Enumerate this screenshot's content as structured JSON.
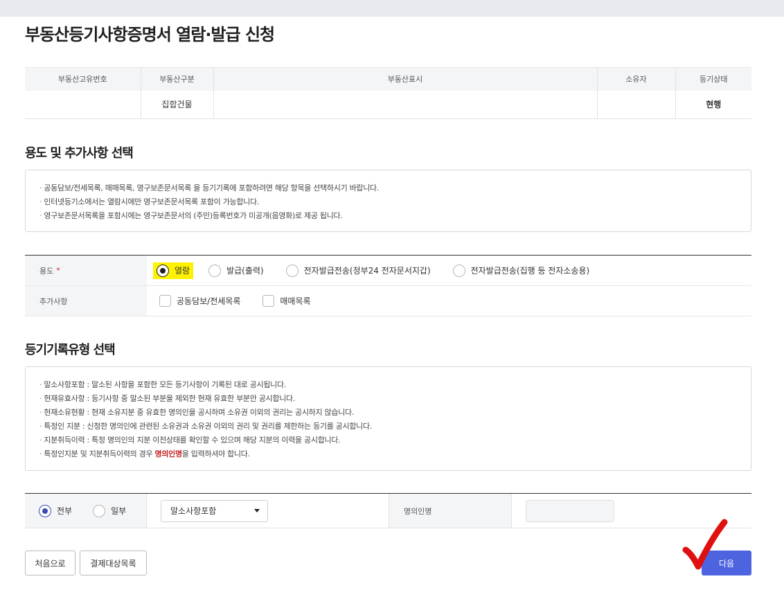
{
  "page_title": "부동산등기사항증명서 열람·발급 신청",
  "property_table": {
    "headers": [
      "부동산고유번호",
      "부동산구분",
      "부동산표시",
      "소유자",
      "등기상태"
    ],
    "row": [
      "",
      "집합건물",
      "",
      "",
      "현행"
    ]
  },
  "purpose_section": {
    "title": "용도 및 추가사항 선택",
    "notices": [
      "공동담보/전세목록, 매매목록, 영구보존문서목록 을 등기기록에 포함하려면 해당 항목을 선택하시기 바랍니다.",
      "인터넷등기소에서는 열람시에만 영구보존문서목록 포함이 가능합니다.",
      "영구보존문서목록을 포함시에는 영구보존문서의 (주민)등록번호가 미공개(음영화)로 제공 됩니다."
    ],
    "purpose_label": "용도",
    "required_mark": "*",
    "purpose_options": [
      "열람",
      "발급(출력)",
      "전자발급전송(정부24 전자문서지갑)",
      "전자발급전송(집행 등 전자소송용)"
    ],
    "purpose_selected": "열람",
    "extras_label": "추가사항",
    "extras_options": [
      "공동담보/전세목록",
      "매매목록"
    ]
  },
  "record_section": {
    "title": "등기기록유형 선택",
    "notices": [
      "말소사항포함 : 말소된 사항을 포함한 모든 등기사항이 기록된 대로 공시됩니다.",
      "현재유효사항 : 등기사항 중 말소된 부분을 제외한 현재 유효한 부분만 공시합니다.",
      "현재소유현황 : 현재 소유지분 중 유효한 명의인을 공시하며 소유권 이외의 권리는 공시하지 않습니다.",
      "특정인 지분 : 신청한 명의인에 관련된 소유권과 소유권 이외의 권리 및 권리를 제한하는 등기를 공시합니다.",
      "지분취득이력 : 특정 명의인의 지분 이전상태를 확인할 수 있으며 해당 지분의 이력을 공시합니다."
    ],
    "last_notice_prefix": "특정인지분 및 지분취득이력의 경우 ",
    "last_notice_emphasis": "명의인명",
    "last_notice_suffix": "을 입력하셔야 합니다.",
    "scope_options": [
      "전부",
      "일부"
    ],
    "scope_selected": "전부",
    "record_type_value": "말소사항포함",
    "owner_name_label": "명의인명",
    "owner_name_value": ""
  },
  "buttons": {
    "first": "처음으로",
    "payment_list": "결제대상목록",
    "next": "다음"
  },
  "colors": {
    "primary": "#4d63e0",
    "highlight": "#fff200",
    "annotation_red": "#e01010",
    "status_blue": "#3b4bb0"
  }
}
